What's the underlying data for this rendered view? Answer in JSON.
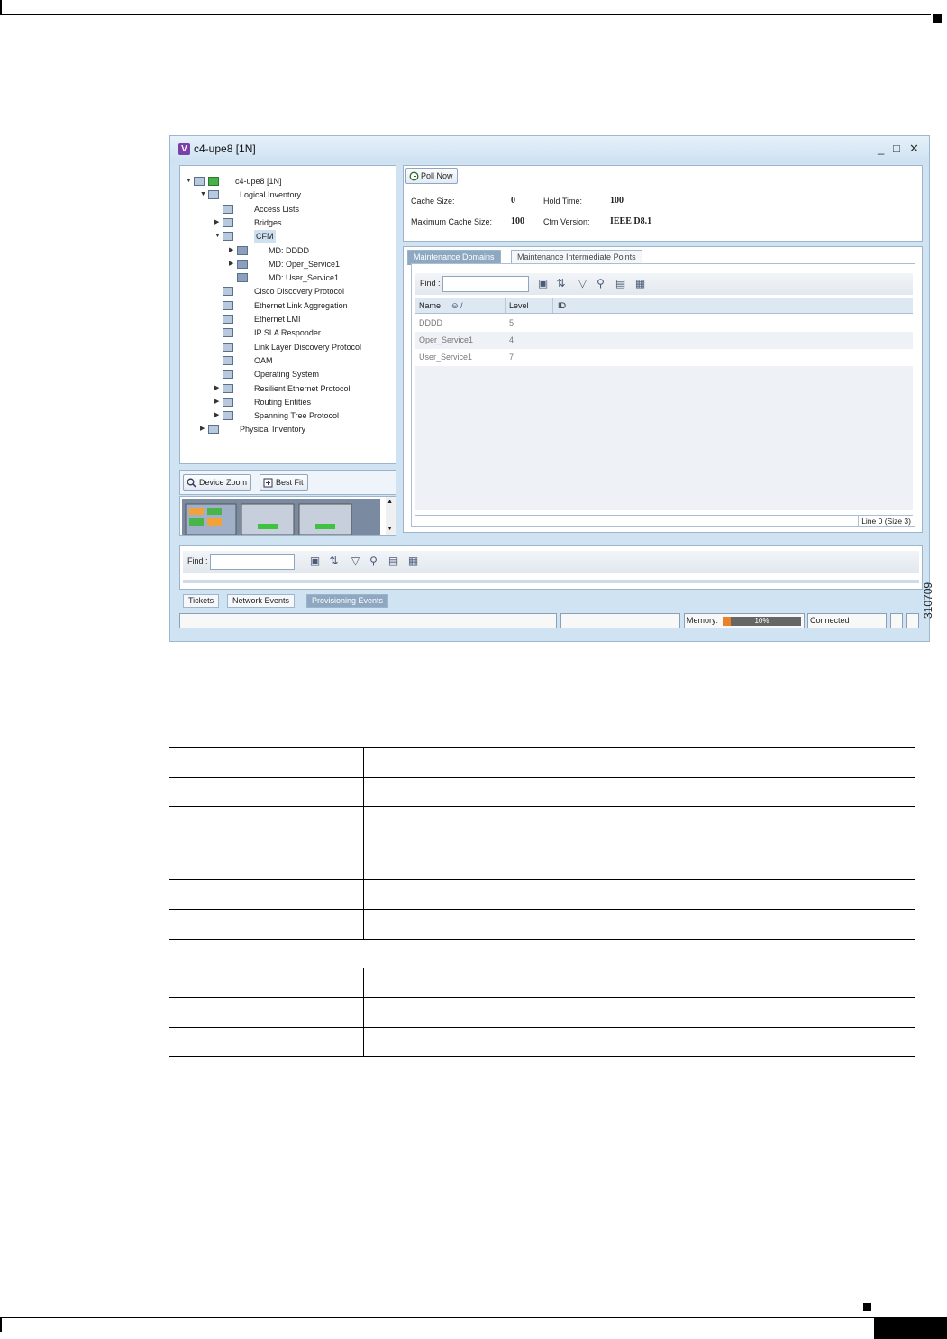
{
  "window": {
    "title": "c4-upe8 [1N]",
    "logo": "V",
    "controls": [
      "_",
      "□",
      "✕"
    ]
  },
  "tree": [
    {
      "label": "c4-upe8 [1N]",
      "level": 0,
      "expander": "▼"
    },
    {
      "label": "Logical Inventory",
      "level": 1,
      "expander": "▼"
    },
    {
      "label": "Access Lists",
      "level": 2,
      "expander": ""
    },
    {
      "label": "Bridges",
      "level": 2,
      "expander": "▶"
    },
    {
      "label": "CFM",
      "level": 2,
      "expander": "▼",
      "selected": true
    },
    {
      "label": "MD: DDDD",
      "level": 3,
      "expander": "▶"
    },
    {
      "label": "MD: Oper_Service1",
      "level": 3,
      "expander": "▶"
    },
    {
      "label": "MD: User_Service1",
      "level": 3,
      "expander": ""
    },
    {
      "label": "Cisco Discovery Protocol",
      "level": 2,
      "expander": ""
    },
    {
      "label": "Ethernet Link Aggregation",
      "level": 2,
      "expander": ""
    },
    {
      "label": "Ethernet LMI",
      "level": 2,
      "expander": ""
    },
    {
      "label": "IP SLA Responder",
      "level": 2,
      "expander": ""
    },
    {
      "label": "Link Layer Discovery Protocol",
      "level": 2,
      "expander": ""
    },
    {
      "label": "OAM",
      "level": 2,
      "expander": ""
    },
    {
      "label": "Operating System",
      "level": 2,
      "expander": ""
    },
    {
      "label": "Resilient Ethernet Protocol",
      "level": 2,
      "expander": "▶"
    },
    {
      "label": "Routing Entities",
      "level": 2,
      "expander": "▶"
    },
    {
      "label": "Spanning Tree Protocol",
      "level": 2,
      "expander": "▶"
    },
    {
      "label": "Physical Inventory",
      "level": 1,
      "expander": "▶"
    }
  ],
  "zoom": {
    "device_zoom": "Device Zoom",
    "best_fit": "Best Fit"
  },
  "poll_now": "Poll Now",
  "info": {
    "cache_size_label": "Cache Size:",
    "cache_size": "0",
    "max_cache_label": "Maximum Cache Size:",
    "max_cache": "100",
    "hold_time_label": "Hold Time:",
    "hold_time": "100",
    "cfm_version_label": "Cfm Version:",
    "cfm_version": "IEEE D8.1"
  },
  "tabs": [
    "Maintenance Domains",
    "Maintenance Intermediate Points"
  ],
  "find_label": "Find :",
  "grid": {
    "columns": [
      "Name",
      "Level",
      "ID"
    ],
    "rows": [
      {
        "name": "DDDD",
        "level": "5",
        "id": ""
      },
      {
        "name": "Oper_Service1",
        "level": "4",
        "id": ""
      },
      {
        "name": "User_Service1",
        "level": "7",
        "id": ""
      }
    ],
    "footer": "Line 0 (Size 3)"
  },
  "event_tabs": [
    "Tickets",
    "Network Events",
    "Provisioning Events"
  ],
  "status": {
    "memory_label": "Memory:",
    "memory_value": "10%",
    "memory_fraction": 0.1,
    "connection": "Connected"
  },
  "figure_number": "310709"
}
